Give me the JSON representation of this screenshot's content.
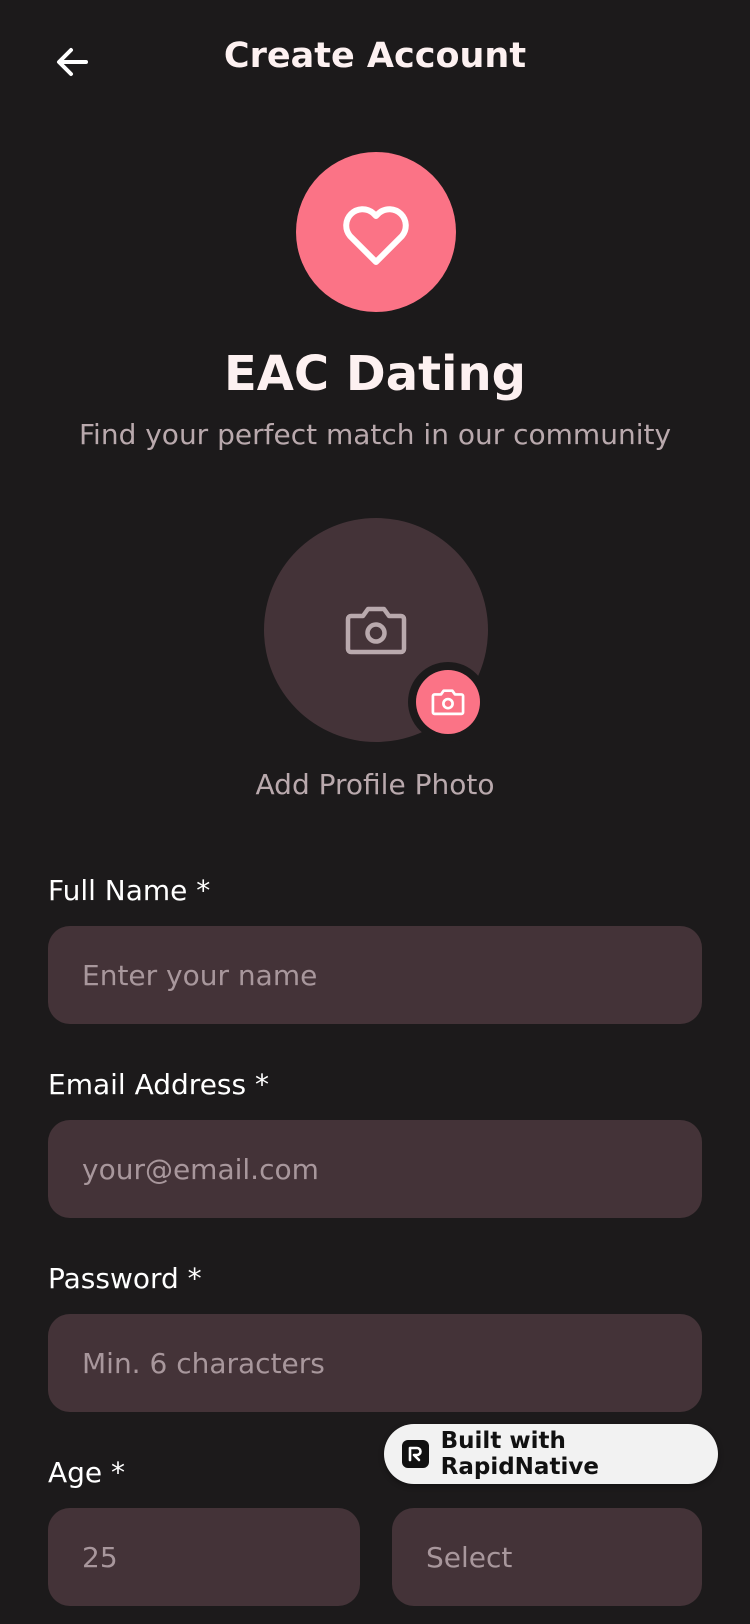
{
  "header": {
    "title": "Create Account",
    "back_icon": "arrow-left-icon"
  },
  "brand": {
    "logo_icon": "heart-icon",
    "name": "EAC Dating",
    "tagline": "Find your perfect match in our community",
    "accent_color": "#fb7386"
  },
  "photo": {
    "icon": "camera-icon",
    "badge_icon": "camera-icon",
    "label": "Add Profile Photo"
  },
  "form": {
    "full_name": {
      "label": "Full Name *",
      "value": "",
      "placeholder": "Enter your name"
    },
    "email": {
      "label": "Email Address *",
      "value": "",
      "placeholder": "your@email.com"
    },
    "password": {
      "label": "Password *",
      "value": "",
      "placeholder": "Min. 6 characters"
    },
    "age": {
      "label": "Age *",
      "value": "",
      "placeholder": "25"
    },
    "second_select": {
      "selected": "Select"
    }
  },
  "badge": {
    "text": "Built with RapidNative"
  }
}
